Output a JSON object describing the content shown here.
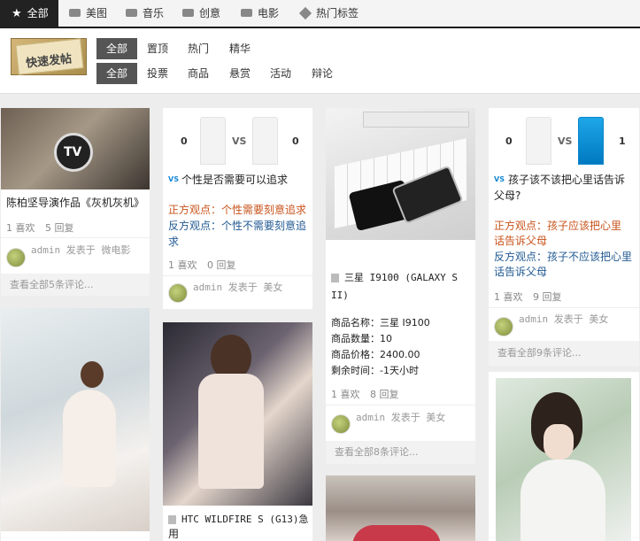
{
  "nav": {
    "items": [
      {
        "label": "全部",
        "icon": "star-icon"
      },
      {
        "label": "美图",
        "icon": "image-icon"
      },
      {
        "label": "音乐",
        "icon": "music-icon"
      },
      {
        "label": "创意",
        "icon": "idea-icon"
      },
      {
        "label": "电影",
        "icon": "film-icon"
      },
      {
        "label": "热门标签",
        "icon": "tag-icon"
      }
    ]
  },
  "filters": {
    "post_button": "快速发帖",
    "row1": [
      "全部",
      "置顶",
      "热门",
      "精华"
    ],
    "row2": [
      "全部",
      "投票",
      "商品",
      "悬赏",
      "活动",
      "辩论"
    ]
  },
  "cards": {
    "c1": {
      "title": "陈柏坚导演作品《灰机灰机》",
      "likes": "1 喜欢",
      "replies": "5 回复",
      "author": "admin 发表于 微电影",
      "footer": "查看全部5条评论..."
    },
    "c2": {
      "left_count": "0",
      "vs": "VS",
      "right_count": "0",
      "badge": "VS",
      "title": "个性是否需要可以追求",
      "pro": "正方观点：个性需要刻意追求",
      "con": "反方观点：个性不需要刻意追求",
      "likes": "1 喜欢",
      "replies": "0 回复",
      "author": "admin 发表于 美女"
    },
    "c3": {
      "title_line1": "三星 I9100 (GALAXY S",
      "title_line2": "II)",
      "name": "商品名称：三星 I9100",
      "qty": "商品数量：10",
      "price": "商品价格：2400.00",
      "remain": "剩余时间：-1天小时",
      "likes": "1 喜欢",
      "replies": "8 回复",
      "author": "admin 发表于 美女",
      "footer": "查看全部8条评论..."
    },
    "c4": {
      "left_count": "0",
      "vs": "VS",
      "right_count": "1",
      "badge": "VS",
      "title_line1": "孩子该不该把心里话告诉",
      "title_line2": "父母?",
      "pro_line1": "正方观点：孩子应该把心里",
      "pro_line2": "话告诉父母",
      "con_line1": "反方观点：孩子不应该把心里",
      "con_line2": "话告诉父母",
      "likes": "1 喜欢",
      "replies": "9 回复",
      "author": "admin 发表于 美女",
      "footer": "查看全部9条评论..."
    },
    "c6": {
      "title_line1": "HTC WILDFIRE S (G13)急",
      "title_line2": "用"
    }
  },
  "colors": {
    "nav_active_bg": "#222222",
    "pro": "#c8531b",
    "con": "#225a93",
    "vote_blue": "#0a86cc"
  }
}
